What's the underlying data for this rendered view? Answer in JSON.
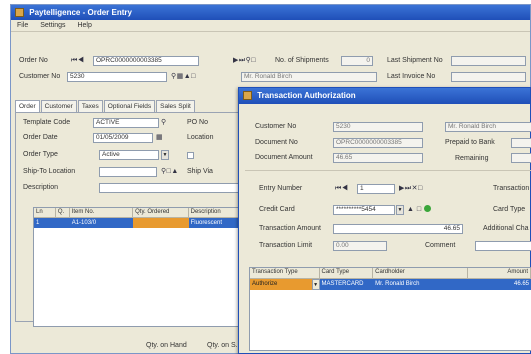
{
  "main_window": {
    "title": "Paytelligence - Order Entry",
    "menu": [
      "File",
      "Settings",
      "Help"
    ],
    "order_no_label": "Order No",
    "order_no_value": "OPRC0000000003385",
    "num_shipments_label": "No. of Shipments",
    "num_shipments_value": "0",
    "last_shipment_label": "Last Shipment No",
    "customer_no_label": "Customer No",
    "customer_no_value": "5230",
    "customer_name_value": "Mr. Ronald Birch",
    "last_invoice_label": "Last Invoice No",
    "tabs": [
      "Order",
      "Customer",
      "Taxes",
      "Optional Fields",
      "Sales Split"
    ],
    "template_code_label": "Template Code",
    "template_code_value": "ACTIVE",
    "po_no_label": "PO No",
    "order_date_label": "Order Date",
    "order_date_value": "01/05/2009",
    "location_label": "Location",
    "order_type_label": "Order Type",
    "order_type_value": "Active",
    "ship_to_label": "Ship-To Location",
    "ship_via_label": "Ship Via",
    "ship_code_label": "Ship Code",
    "description_label": "Description",
    "grid_headers": [
      "Ln",
      "Q.",
      "Item No.",
      "Qty. Ordered",
      "Description"
    ],
    "grid_row": {
      "ln": "1",
      "q": "",
      "item": "A1-103/0",
      "qty": "",
      "desc": "Fluorescent"
    },
    "qty_on_hand_label": "Qty. on Hand",
    "qty_on_so_label": "Qty. on S.O."
  },
  "dialog": {
    "title": "Transaction Authorization",
    "customer_no_label": "Customer No",
    "customer_no_value": "5230",
    "customer_name_value": "Mr. Ronald Birch",
    "document_no_label": "Document No",
    "document_no_value": "OPRC0000000003385",
    "prepaid_label": "Prepaid to Bank",
    "document_amount_label": "Document Amount",
    "document_amount_value": "46.65",
    "remaining_label": "Remaining",
    "entry_number_label": "Entry Number",
    "entry_number_value": "1",
    "transaction_label": "Transaction T",
    "credit_card_label": "Credit Card",
    "credit_card_value": "**********5454",
    "card_type_label": "Card Type",
    "transaction_amount_label": "Transaction Amount",
    "transaction_amount_value": "46.65",
    "additional_charge_label": "Additional Cha",
    "transaction_limit_label": "Transaction Limit",
    "transaction_limit_value": "0.00",
    "comment_label": "Comment",
    "grid_headers": [
      "Transaction Type",
      "Card Type",
      "Cardholder",
      "Amount"
    ],
    "grid_row": {
      "type": "Authorize",
      "card": "MASTERCARD",
      "holder": "Mr. Ronald Birch",
      "amount": "46.65"
    }
  }
}
